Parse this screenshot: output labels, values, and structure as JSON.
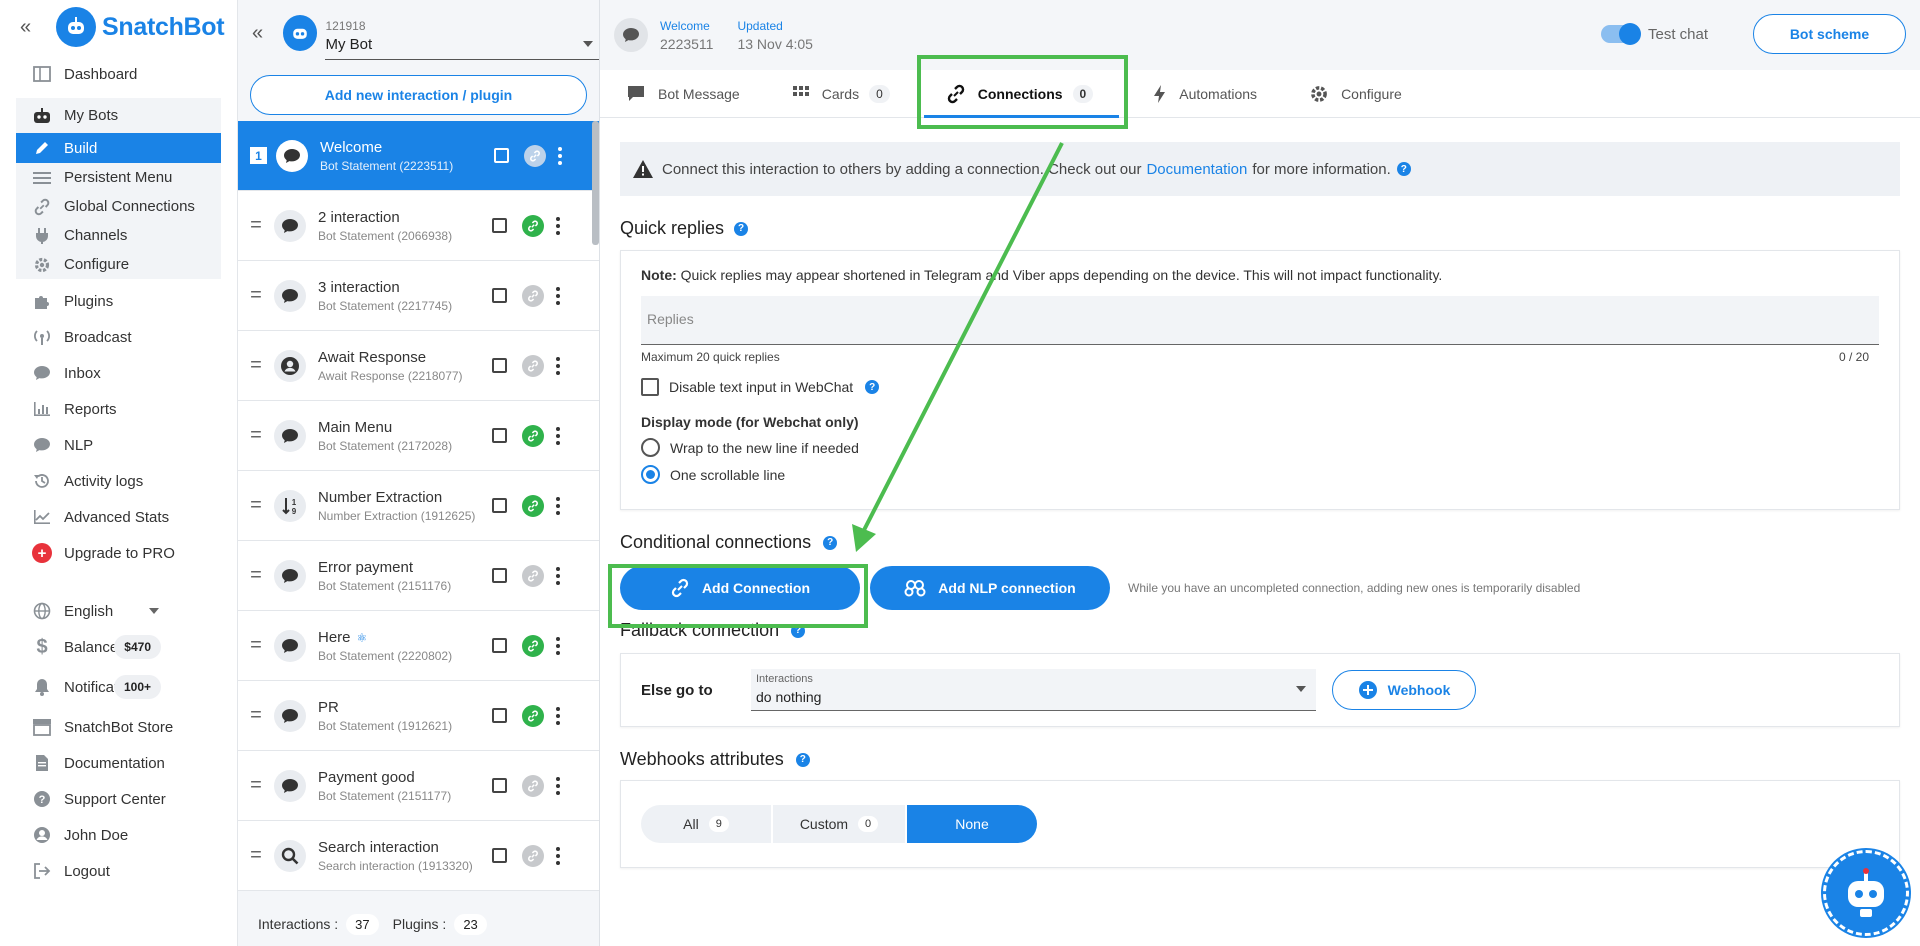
{
  "app": {
    "name": "SnatchBot"
  },
  "nav": {
    "items_top": [
      {
        "label": "Dashboard",
        "icon": "dashboard-icon"
      }
    ],
    "group": [
      {
        "label": "My Bots",
        "icon": "robot-icon"
      },
      {
        "label": "Build",
        "icon": "pencil-icon",
        "active": true
      },
      {
        "label": "Persistent Menu",
        "icon": "menu-icon"
      },
      {
        "label": "Global Connections",
        "icon": "link-icon"
      },
      {
        "label": "Channels",
        "icon": "plug-icon"
      },
      {
        "label": "Configure",
        "icon": "gear-icon"
      }
    ],
    "items_mid": [
      {
        "label": "Plugins",
        "icon": "puzzle-icon"
      },
      {
        "label": "Broadcast",
        "icon": "broadcast-icon"
      },
      {
        "label": "Inbox",
        "icon": "chat-icon"
      },
      {
        "label": "Reports",
        "icon": "bar-chart-icon"
      },
      {
        "label": "NLP",
        "icon": "chat-icon"
      },
      {
        "label": "Activity logs",
        "icon": "history-icon"
      },
      {
        "label": "Advanced Stats",
        "icon": "line-chart-icon"
      },
      {
        "label": "Upgrade to PRO",
        "icon": "plus-circle-icon"
      }
    ],
    "language": "English",
    "balance": {
      "label": "Balance",
      "value": "$470"
    },
    "notifications": {
      "label": "Notifications",
      "value": "100+"
    },
    "items_bottom": [
      {
        "label": "SnatchBot Store",
        "icon": "store-icon"
      },
      {
        "label": "Documentation",
        "icon": "document-icon"
      },
      {
        "label": "Support Center",
        "icon": "question-icon"
      },
      {
        "label": "John Doe",
        "icon": "user-icon"
      },
      {
        "label": "Logout",
        "icon": "logout-icon"
      }
    ]
  },
  "bot": {
    "id": "121918",
    "name": "My Bot",
    "add_label": "Add new interaction / plugin"
  },
  "interactions": [
    {
      "name": "Welcome",
      "sub": "Bot Statement (2223511)",
      "num": "1",
      "icon": "chat-bubble-icon",
      "link": "grey",
      "active": true
    },
    {
      "name": "2 interaction",
      "sub": "Bot Statement (2066938)",
      "icon": "chat-bubble-icon",
      "link": "green"
    },
    {
      "name": "3 interaction",
      "sub": "Bot Statement (2217745)",
      "icon": "chat-bubble-icon",
      "link": "grey"
    },
    {
      "name": "Await Response",
      "sub": "Await Response (2218077)",
      "icon": "user-circle-icon",
      "link": "grey"
    },
    {
      "name": "Main Menu",
      "sub": "Bot Statement (2172028)",
      "icon": "chat-bubble-icon",
      "link": "green"
    },
    {
      "name": "Number Extraction",
      "sub": "Number Extraction (1912625)",
      "icon": "number-sort-icon",
      "link": "green"
    },
    {
      "name": "Error payment",
      "sub": "Bot Statement (2151176)",
      "icon": "chat-bubble-icon",
      "link": "grey"
    },
    {
      "name": "Here",
      "sub": "Bot Statement (2220802)",
      "icon": "chat-bubble-icon",
      "link": "green"
    },
    {
      "name": "PR",
      "sub": "Bot Statement (1912621)",
      "icon": "chat-bubble-icon",
      "link": "green"
    },
    {
      "name": "Payment good",
      "sub": "Bot Statement (2151177)",
      "icon": "chat-bubble-icon",
      "link": "grey"
    },
    {
      "name": "Search interaction",
      "sub": "Search interaction (1913320)",
      "icon": "search-icon",
      "link": "grey"
    }
  ],
  "footer": {
    "interactions_label": "Interactions :",
    "interactions_count": "37",
    "plugins_label": "Plugins :",
    "plugins_count": "23"
  },
  "header": {
    "welcome_label": "Welcome",
    "welcome_value": "2223511",
    "updated_label": "Updated",
    "updated_value": "13 Nov 4:05",
    "test_chat": "Test chat",
    "scheme": "Bot scheme"
  },
  "tabs": [
    {
      "label": "Bot Message",
      "icon": "message-icon"
    },
    {
      "label": "Cards",
      "count": "0",
      "icon": "grid-icon"
    },
    {
      "label": "Connections",
      "count": "0",
      "icon": "link-icon",
      "active": true
    },
    {
      "label": "Automations",
      "icon": "bolt-icon"
    },
    {
      "label": "Configure",
      "icon": "gear-icon"
    }
  ],
  "info": {
    "before": "Connect this interaction to others by adding a connection. Check out our",
    "link": "Documentation",
    "after": "for more information."
  },
  "quick_replies": {
    "title": "Quick replies",
    "note_bold": "Note:",
    "note": "Quick replies may appear shortened in Telegram and Viber apps depending on the device. This will not impact functionality.",
    "placeholder": "Replies",
    "max": "Maximum 20 quick replies",
    "count": "0 / 20",
    "disable_text": "Disable text input in WebChat",
    "display_title": "Display mode (for Webchat only)",
    "option_wrap": "Wrap to the new line if needed",
    "option_scroll": "One scrollable line"
  },
  "conditional": {
    "title": "Conditional connections",
    "add": "Add Connection",
    "add_nlp": "Add NLP connection",
    "note": "While you have an uncompleted connection, adding new ones is temporarily disabled"
  },
  "fallback": {
    "title": "Fallback connection",
    "else": "Else go to",
    "select_label": "Interactions",
    "select_value": "do nothing",
    "webhook": "Webhook"
  },
  "webhooks": {
    "title": "Webhooks attributes",
    "segments": [
      {
        "label": "All",
        "count": "9"
      },
      {
        "label": "Custom",
        "count": "0"
      },
      {
        "label": "None",
        "active": true
      }
    ]
  },
  "colors": {
    "primary": "#1a83e6",
    "highlight": "#4cbc4f",
    "link_active": "#2fb24b"
  }
}
